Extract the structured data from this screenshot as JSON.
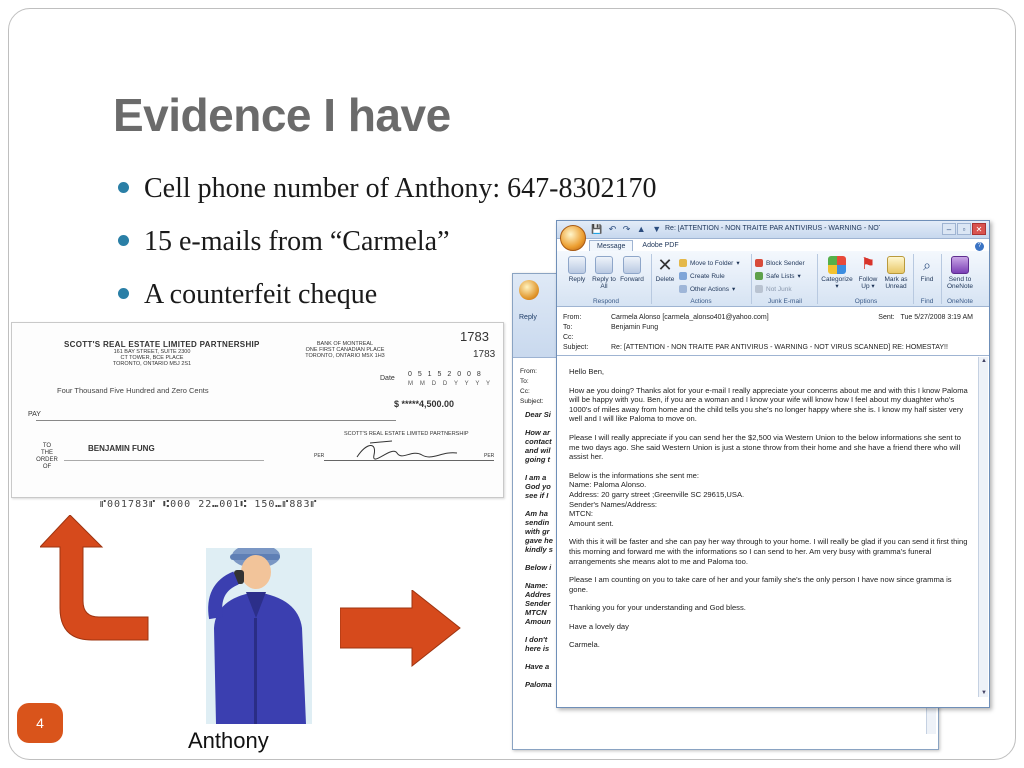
{
  "slide": {
    "title": "Evidence I have",
    "bullets": [
      "Cell phone number of Anthony: 647-8302170",
      "15 e-mails from “Carmela”",
      "A counterfeit cheque"
    ],
    "person_caption": "Anthony",
    "page_number": "4",
    "accent_color": "#d9541b",
    "bullet_color": "#2a7fa6"
  },
  "cheque": {
    "company": "SCOTT'S REAL ESTATE LIMITED PARTNERSHIP",
    "address": [
      "161 BAY STREET, SUITE 2300",
      "CT TOWER, BCE PLACE",
      "TORONTO, ONTARIO  M5J 2S1"
    ],
    "bank": [
      "BANK OF MONTREAL",
      "ONE FIRST CANADIAN PLACE",
      "TORONTO, ONTARIO  M5X 1H3"
    ],
    "number_top": "1783",
    "number_small": "1783",
    "date_label": "Date",
    "date": "0 5 1 5 2 0 0 8",
    "date_format": "M M D D Y Y Y Y",
    "amount_words": "Four Thousand Five Hundred and Zero Cents",
    "amount": "$ *****4,500.00",
    "pay_label": "PAY",
    "order_label": [
      "TO",
      "THE",
      "ORDER",
      "OF"
    ],
    "payee": "BENJAMIN FUNG",
    "signature_company": "SCOTT'S REAL ESTATE LIMITED PARTNERSHIP",
    "per_label": "PER",
    "micr": "⑈001783⑈  ⑆000 22⑉001⑆     150⑉⑈883⑈"
  },
  "email_back": {
    "reply_label": "Reply",
    "header_labels": [
      "From:",
      "To:",
      "Cc:",
      "Subject:"
    ],
    "body_fragments": [
      "Dear Si",
      "",
      "How ar",
      "contact",
      "and wil",
      "going t",
      "",
      "I am a",
      "God yo",
      "see if I",
      "",
      "Am ha",
      "sendin",
      "with gr",
      "gave he",
      "kindly s",
      "",
      "Below i",
      "",
      "Name:",
      "Addres",
      "Sender",
      "MTCN",
      "Amoun",
      "",
      "I don't",
      "here is",
      "",
      "Have a",
      "",
      "Paloma"
    ]
  },
  "email": {
    "window_title": "Re: [ATTENTION - NON TRAITE PAR ANTIVIRUS - WARNING - NOT VIR...",
    "tabs": [
      "Message",
      "Adobe PDF"
    ],
    "ribbon": {
      "reply": "Reply",
      "reply_all": "Reply to All",
      "forward": "Forward",
      "delete": "Delete",
      "move_to_folder": "Move to Folder",
      "create_rule": "Create Rule",
      "other_actions": "Other Actions",
      "block_sender": "Block Sender",
      "safe_lists": "Safe Lists",
      "not_junk": "Not Junk",
      "categorize": "Categorize",
      "follow_up": "Follow Up",
      "mark_as_unread": "Mark as Unread",
      "find": "Find",
      "send_to_onenote": "Send to OneNote",
      "groups": [
        "Respond",
        "Actions",
        "Junk E-mail",
        "Options",
        "Find",
        "OneNote"
      ]
    },
    "from_label": "From:",
    "from": "Carmela Alonso [carmela_alonso401@yahoo.com]",
    "to_label": "To:",
    "to": "Benjamin Fung",
    "cc_label": "Cc:",
    "subject_label": "Subject:",
    "subject": "Re: [ATTENTION - NON TRAITE PAR ANTIVIRUS - WARNING - NOT VIRUS SCANNED] RE: HOMESTAY!!",
    "sent_label": "Sent:",
    "sent": "Tue 5/27/2008 3:19 AM",
    "body": [
      "Hello Ben,",
      "How ae you doing? Thanks alot for your e-mail I really appreciate your concerns about me and with this I know Paloma will be happy with you. Ben, if you are a woman and I know your wife will know how I feel about my duaghter who's 1000's of miles away from home and the child tells you she's no longer happy where she is. I know my half sister very well and I will like Paloma to move on.",
      "Please I will really appreciate if you can send her the $2,500 via Western Union to the below informations she sent to me two days ago. She said Western Union is just a stone throw from their home and she have a friend there who will assist her.",
      "Below is the informations she sent me:\nName: Paloma Alonso.\nAddress: 20 garry street ;Greenville SC 29615,USA.\nSender's Names/Address:\nMTCN:\nAmount sent.",
      "With this it will be faster and she can pay her way through to your home. I will really be glad if you can send it first thing this morning and forward me with the informations so I can send to her. Am very busy with gramma's funeral arrangements she means alot to me and Paloma too.",
      "Please I am counting on you to take care of her and your family she's the only person I have now since gramma is gone.",
      "Thanking you for your understanding and God bless.",
      "",
      "Have a lovely day",
      "Carmela."
    ]
  }
}
